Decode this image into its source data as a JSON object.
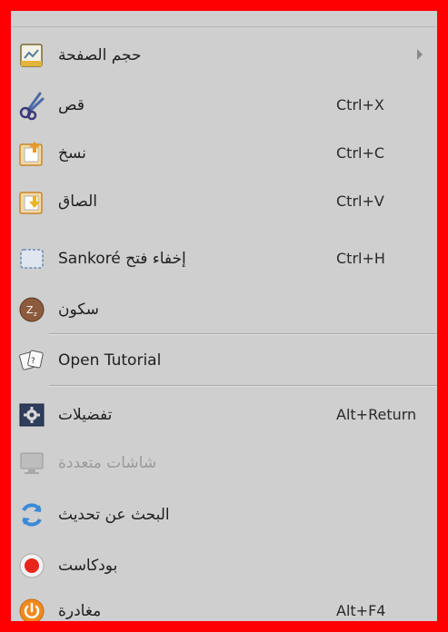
{
  "menu": {
    "items": [
      {
        "label": "حجم الصفحة",
        "shortcut": "",
        "icon": "page-size-icon",
        "has_submenu": true
      },
      {
        "label": "قص",
        "shortcut": "Ctrl+X",
        "icon": "scissors-icon"
      },
      {
        "label": "نسخ",
        "shortcut": "Ctrl+C",
        "icon": "copy-icon"
      },
      {
        "label": "الصاق",
        "shortcut": "Ctrl+V",
        "icon": "paste-icon"
      },
      {
        "label": "Sankoré إخفاء فتح",
        "shortcut": "Ctrl+H",
        "icon": "hide-selection-icon"
      },
      {
        "label": "سكون",
        "shortcut": "",
        "icon": "sleep-icon"
      },
      {
        "label": "Open Tutorial",
        "shortcut": "",
        "icon": "tutorial-icon"
      },
      {
        "label": "تفضيلات",
        "shortcut": "Alt+Return",
        "icon": "preferences-icon"
      },
      {
        "label": "شاشات متعددة",
        "shortcut": "",
        "icon": "multi-screen-icon",
        "disabled": true
      },
      {
        "label": "البحث عن تحديث",
        "shortcut": "",
        "icon": "check-update-icon"
      },
      {
        "label": "بودكاست",
        "shortcut": "",
        "icon": "podcast-icon"
      },
      {
        "label": "مغادرة",
        "shortcut": "Alt+F4",
        "icon": "quit-icon"
      }
    ]
  },
  "colors": {
    "frame": "#ff0000",
    "menu_bg": "#cfcfcf",
    "text": "#202020",
    "disabled_text": "#9a9a9a"
  }
}
